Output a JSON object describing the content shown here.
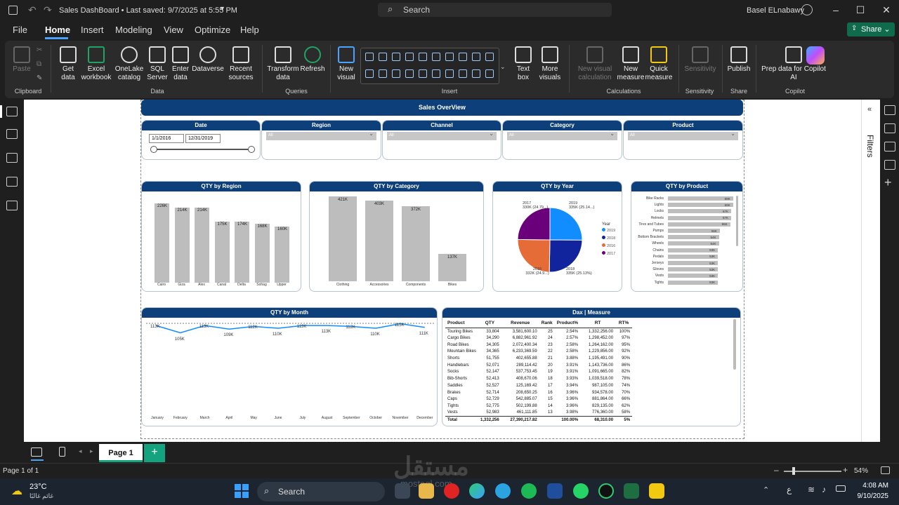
{
  "titlebar": {
    "title": "Sales DashBoard • Last saved: 9/7/2025 at 5:55 PM",
    "search": "Search",
    "user": "Basel ELnabawy"
  },
  "menu": {
    "file": "File",
    "home": "Home",
    "insert": "Insert",
    "modeling": "Modeling",
    "view": "View",
    "optimize": "Optimize",
    "help": "Help",
    "share": "Share"
  },
  "ribbon": {
    "paste": "Paste",
    "clipboard": "Clipboard",
    "get_data": "Get data",
    "excel": "Excel workbook",
    "onelake": "OneLake catalog",
    "sql": "SQL Server",
    "enter": "Enter data",
    "dataverse": "Dataverse",
    "recent": "Recent sources",
    "data": "Data",
    "transform": "Transform data",
    "refresh": "Refresh",
    "queries": "Queries",
    "new_visual": "New visual",
    "text_box": "Text box",
    "more_visuals": "More visuals",
    "insert": "Insert",
    "new_visual_calc": "New visual calculation",
    "new_measure": "New measure",
    "quick_measure": "Quick measure",
    "calculations": "Calculations",
    "sensitivity": "Sensitivity",
    "sensitivity_grp": "Sensitivity",
    "publish": "Publish",
    "share_grp": "Share",
    "prep": "Prep data for Copilot AI",
    "copilot": "Copilot"
  },
  "rightpane": {
    "filters": "Filters"
  },
  "report": {
    "title": "Sales OverView",
    "slicers": {
      "date": {
        "label": "Date",
        "from": "1/1/2016",
        "to": "12/31/2019"
      },
      "region": {
        "label": "Region",
        "value": "All"
      },
      "channel": {
        "label": "Channel",
        "value": "All"
      },
      "category": {
        "label": "Category",
        "value": "All"
      },
      "product": {
        "label": "Product",
        "value": "All"
      }
    },
    "qty_region": {
      "title": "QTY by Region",
      "categories": [
        "Cairo",
        "Giza",
        "Alex",
        "Canal",
        "Delta",
        "Sohag",
        "Upper"
      ],
      "labels": [
        "226K",
        "214K",
        "214K",
        "175K",
        "174K",
        "168K",
        "160K"
      ],
      "values": [
        226,
        214,
        214,
        175,
        174,
        168,
        160
      ]
    },
    "qty_category": {
      "title": "QTY by Category",
      "categories": [
        "Clothing",
        "Accessories",
        "Components",
        "Bikes"
      ],
      "labels": [
        "421K",
        "403K",
        "372K",
        "137K"
      ],
      "values": [
        421,
        403,
        372,
        137
      ]
    },
    "qty_year": {
      "title": "QTY by Year",
      "legend_title": "Year",
      "legend": [
        "2019",
        "2018",
        "2016",
        "2017"
      ],
      "labels": {
        "2017a": "2017",
        "2017b": "330K (24.79...)",
        "2019a": "2019",
        "2019b": "335K (25.14...)",
        "2016a": "2016",
        "2016b": "332K (24.9...)",
        "2018a": "2018",
        "2018b": "335K (25.13%)"
      },
      "colors": [
        "#118dff",
        "#12239e",
        "#e66c37",
        "#6b007b"
      ]
    },
    "qty_product": {
      "title": "QTY by Product",
      "items": [
        {
          "name": "Bike Racks",
          "label": "69K",
          "value": 69
        },
        {
          "name": "Lights",
          "label": "69K",
          "value": 69
        },
        {
          "name": "Locks",
          "label": "67K",
          "value": 67
        },
        {
          "name": "Helmets",
          "label": "67K",
          "value": 67
        },
        {
          "name": "Tires and Tubes",
          "label": "66K",
          "value": 66
        },
        {
          "name": "Pumps",
          "label": "55K",
          "value": 55
        },
        {
          "name": "Bottom Brackets",
          "label": "54K",
          "value": 54
        },
        {
          "name": "Wheels",
          "label": "54K",
          "value": 54
        },
        {
          "name": "Chains",
          "label": "53K",
          "value": 53
        },
        {
          "name": "Pedals",
          "label": "53K",
          "value": 53
        },
        {
          "name": "Jerseys",
          "label": "53K",
          "value": 53
        },
        {
          "name": "Gloves",
          "label": "53K",
          "value": 53
        },
        {
          "name": "Vests",
          "label": "53K",
          "value": 53
        },
        {
          "name": "Tights",
          "label": "53K",
          "value": 53
        }
      ]
    },
    "qty_month": {
      "title": "QTY by Month",
      "months": [
        "January",
        "February",
        "March",
        "April",
        "May",
        "June",
        "July",
        "August",
        "September",
        "October",
        "November",
        "December"
      ],
      "labels": [
        "113K",
        "105K",
        "113K",
        "109K",
        "112K",
        "110K",
        "113K",
        "113K",
        "112K",
        "110K",
        "115K",
        "111K"
      ],
      "values": [
        113,
        105,
        113,
        109,
        112,
        110,
        113,
        113,
        112,
        110,
        115,
        111
      ]
    },
    "dax": {
      "title": "Dax | Measure",
      "headers": [
        "Product",
        "QTY",
        "Revenue",
        "Rank",
        "Product%",
        "RT",
        "RT%"
      ],
      "rows": [
        [
          "Touring Bikes",
          "33,804",
          "3,581,600.10",
          "25",
          "2.54%",
          "1,332,256.00",
          "100%"
        ],
        [
          "Cargo Bikes",
          "34,290",
          "6,882,961.92",
          "24",
          "2.57%",
          "1,298,452.00",
          "97%"
        ],
        [
          "Road Bikes",
          "34,305",
          "2,072,400.34",
          "23",
          "2.58%",
          "1,264,162.00",
          "95%"
        ],
        [
          "Mountain Bikes",
          "34,365",
          "6,233,369.59",
          "22",
          "2.58%",
          "1,229,856.00",
          "92%"
        ],
        [
          "Shorts",
          "51,755",
          "402,655.88",
          "21",
          "3.88%",
          "1,195,491.00",
          "90%"
        ],
        [
          "Handlebars",
          "52,071",
          "289,114.42",
          "20",
          "3.91%",
          "1,143,736.00",
          "86%"
        ],
        [
          "Socks",
          "52,147",
          "537,753.45",
          "19",
          "3.91%",
          "1,091,665.00",
          "82%"
        ],
        [
          "Bib-Shorts",
          "52,413",
          "408,670.06",
          "18",
          "3.93%",
          "1,039,518.00",
          "78%"
        ],
        [
          "Saddles",
          "52,527",
          "125,169.42",
          "17",
          "3.94%",
          "987,105.00",
          "74%"
        ],
        [
          "Brakes",
          "52,714",
          "208,650.25",
          "16",
          "3.96%",
          "934,578.00",
          "70%"
        ],
        [
          "Caps",
          "52,729",
          "542,885.07",
          "15",
          "3.96%",
          "881,864.00",
          "66%"
        ],
        [
          "Tights",
          "52,775",
          "502,199.88",
          "14",
          "3.96%",
          "829,135.00",
          "62%"
        ],
        [
          "Vests",
          "52,983",
          "461,111.85",
          "13",
          "3.98%",
          "776,360.00",
          "58%"
        ]
      ],
      "total": [
        "Total",
        "1,332,256",
        "27,390,217.82",
        "",
        "100.00%",
        "68,310.00",
        "5%"
      ]
    }
  },
  "pages": {
    "page1": "Page 1"
  },
  "status": {
    "page": "Page 1 of 1",
    "zoom": "54%"
  },
  "taskbar": {
    "temp": "23°C",
    "weather": "غائم غالبًا",
    "search": "Search",
    "time": "4:08 AM",
    "date": "9/10/2025",
    "lang": "ع",
    "watermark": "مستقل",
    "watermark_url": "mostaql.com"
  }
}
